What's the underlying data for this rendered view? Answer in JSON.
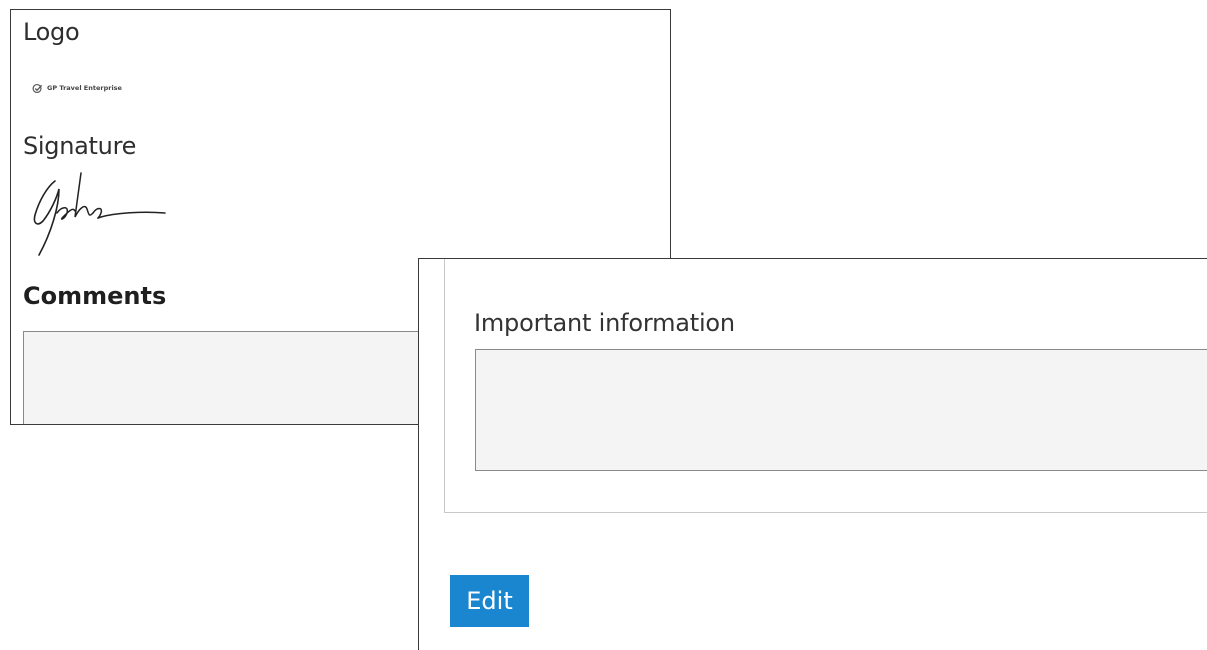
{
  "back_panel": {
    "logo_label": "Logo",
    "logo_text": "GP Travel Enterprise",
    "signature_label": "Signature",
    "comments_label": "Comments",
    "comments_value": ""
  },
  "front_panel": {
    "important_label": "Important information",
    "important_value": "",
    "edit_label": "Edit"
  },
  "colors": {
    "edit_button_bg": "#1a86cf",
    "field_bg": "#f4f4f4"
  }
}
